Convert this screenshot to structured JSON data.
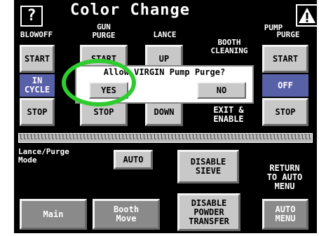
{
  "header": {
    "title": "Color Change",
    "help_label": "?",
    "warning_icon": "warning-triangle-icon"
  },
  "columns": {
    "blowoff": "BLOWOFF",
    "gun_purge": "GUN\nPURGE",
    "lance": "LANCE",
    "booth_cleaning": "BOOTH\nCLEANING",
    "pump_purge_top": "PUMP",
    "pump_purge": "PURGE"
  },
  "buttons": {
    "blowoff_start": "START",
    "gun_purge_start": "START",
    "lance_up": "UP",
    "pump_start": "START",
    "blowoff_status": "IN\nCYCLE",
    "pump_status": "OFF",
    "blowoff_stop": "STOP",
    "gun_purge_stop": "STOP",
    "lance_down": "DOWN",
    "exit_enable": "EXIT &\nENABLE",
    "pump_stop": "STOP",
    "auto": "AUTO",
    "disable_sieve": "DISABLE\nSIEVE",
    "return_auto": "RETURN\nTO AUTO\nMENU",
    "main": "Main",
    "booth_move": "Booth\nMove",
    "disable_powder": "DISABLE\nPOWDER\nTRANSFER",
    "auto_menu": "AUTO\nMENU"
  },
  "lance_purge_mode": "Lance/Purge\nMode",
  "bar_text": "llllllllllllllllllllllllllllllllllllllllllllllllllllllllllllllllllllllllllllllllllllllllllllllllllllllll",
  "dialog": {
    "question": "Allow VIRGIN Pump Purge?",
    "yes": "YES",
    "no": "NO"
  },
  "colors": {
    "highlight_circle": "#2ecc2e",
    "button_gray": "#c8c8c8",
    "button_blue": "#5860a8"
  }
}
